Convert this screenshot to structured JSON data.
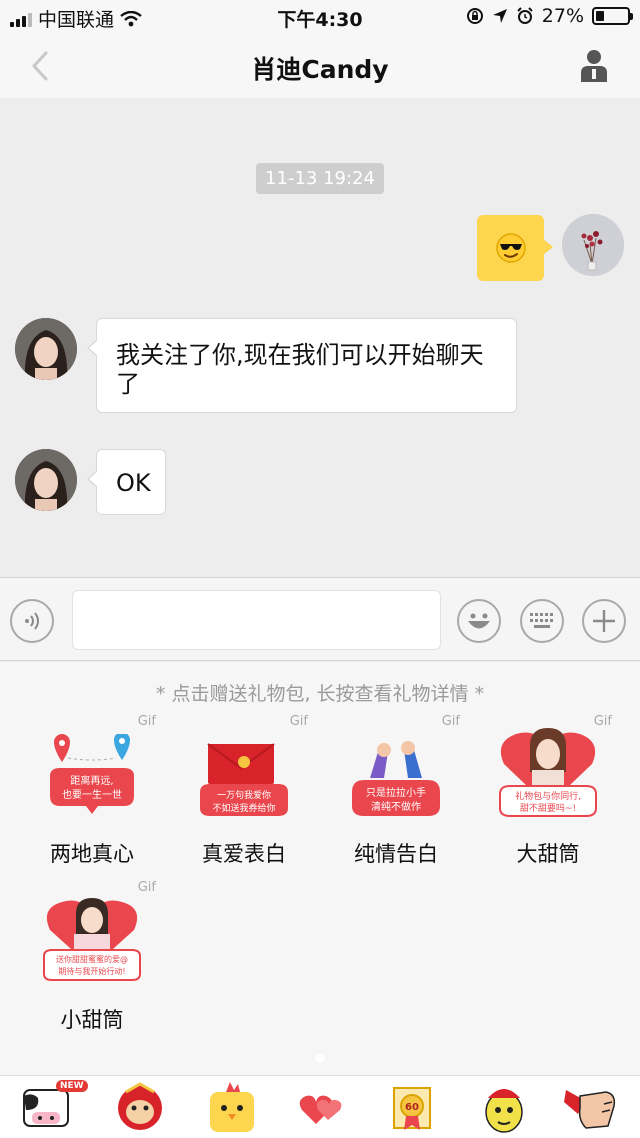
{
  "status_bar": {
    "carrier": "中国联通",
    "time": "下午4:30",
    "battery_percent_text": "27%",
    "battery_level": 0.27,
    "icons": [
      "signal-icon",
      "wifi-icon",
      "rotation-lock-icon",
      "location-arrow-icon",
      "alarm-icon",
      "battery-icon"
    ]
  },
  "nav": {
    "title": "肖迪Candy",
    "back_icon": "chevron-left-icon",
    "profile_icon": "person-icon"
  },
  "chat": {
    "timestamp": "11-13 19:24",
    "messages": [
      {
        "from": "me",
        "type": "emoji",
        "content": "sunglasses-emoji"
      },
      {
        "from": "other",
        "type": "text",
        "text": "我关注了你,现在我们可以开始聊天了"
      },
      {
        "from": "other",
        "type": "text",
        "text": "OK"
      }
    ]
  },
  "input_bar": {
    "value": "",
    "icons": [
      "voice-icon",
      "emoji-icon",
      "keyboard-icon",
      "plus-icon"
    ]
  },
  "gift_panel": {
    "hint": "* 点击赠送礼物包, 长按查看礼物详情 *",
    "gift_tag": "Gif",
    "gifts": [
      {
        "name": "两地真心",
        "tag": "Gif",
        "caption": [
          "距离再远,",
          "也要一生一世"
        ]
      },
      {
        "name": "真爱表白",
        "tag": "Gif",
        "caption": [
          "一万句我爱你",
          "不如送我券给你"
        ]
      },
      {
        "name": "纯情告白",
        "tag": "Gif",
        "caption": [
          "只是拉拉小手",
          "清纯不做作"
        ]
      },
      {
        "name": "大甜筒",
        "tag": "Gif",
        "caption": [
          "礼物包与你同行,",
          "甜不甜要吗~!"
        ]
      },
      {
        "name": "小甜筒",
        "tag": "Gif",
        "caption": [
          "送你甜甜蜜蜜的爱@",
          "期待与我开始行动!"
        ]
      }
    ],
    "page_count": 1,
    "active_page": 1
  },
  "sticker_bar": {
    "new_badge": "NEW",
    "level_badge": "60",
    "tabs": [
      "cow-sticker-icon",
      "monkey-sticker-icon",
      "chicken-sticker-icon",
      "hearts-sticker-icon",
      "certificate-sticker-icon",
      "yellow-face-sticker-icon",
      "fist-sticker-icon"
    ]
  },
  "colors": {
    "bubble_mine": "#fdd54f",
    "gift_red": "#e9474d",
    "background": "#ededed"
  }
}
